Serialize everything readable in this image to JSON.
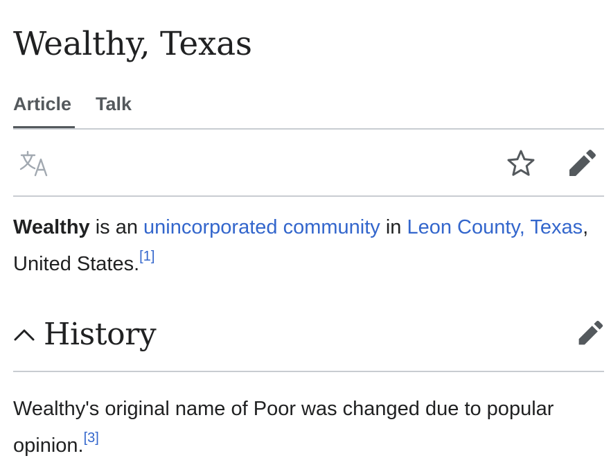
{
  "page": {
    "title": "Wealthy, Texas"
  },
  "tabs": [
    {
      "label": "Article",
      "selected": true
    },
    {
      "label": "Talk",
      "selected": false
    }
  ],
  "toolbar": {
    "language_icon": "translate-icon",
    "watch_icon": "star-icon",
    "edit_icon": "pencil-icon"
  },
  "lead": {
    "subject": "Wealthy",
    "text1": " is an ",
    "link1": "unincorporated community",
    "text2": " in ",
    "link2": "Leon County, Texas",
    "text3": ", United States.",
    "ref": "[1]"
  },
  "sections": [
    {
      "title": "History",
      "expanded": true,
      "toggle_icon": "chevron-up-icon",
      "edit_icon": "pencil-icon",
      "body_text": "Wealthy's original name of Poor was changed due to popular opinion.",
      "ref": "[3]"
    }
  ],
  "colors": {
    "link": "#3366cc",
    "text": "#202122",
    "tab_text": "#54595d",
    "divider": "#c8ccd1",
    "icon_muted": "#a2a9b1"
  }
}
